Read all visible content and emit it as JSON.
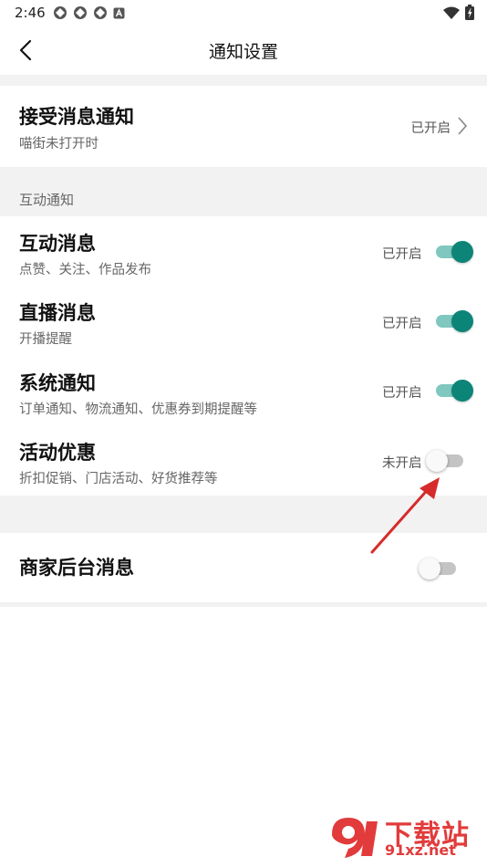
{
  "status_bar": {
    "time": "2:46"
  },
  "header": {
    "title": "通知设置"
  },
  "receive": {
    "title": "接受消息通知",
    "subtitle": "喵街未打开时",
    "status": "已开启"
  },
  "section": {
    "label": "互动通知"
  },
  "items": [
    {
      "title": "互动消息",
      "subtitle": "点赞、关注、作品发布",
      "status": "已开启",
      "enabled": true
    },
    {
      "title": "直播消息",
      "subtitle": "开播提醒",
      "status": "已开启",
      "enabled": true
    },
    {
      "title": "系统通知",
      "subtitle": "订单通知、物流通知、优惠券到期提醒等",
      "status": "已开启",
      "enabled": true
    },
    {
      "title": "活动优惠",
      "subtitle": "折扣促销、门店活动、好货推荐等",
      "status": "未开启",
      "enabled": false
    }
  ],
  "merchant": {
    "title": "商家后台消息",
    "enabled": false
  },
  "watermark": {
    "text": "下载站",
    "domain": "91xz.net"
  },
  "colors": {
    "toggle_on": "#0c8578",
    "toggle_on_track": "#7fc7bf",
    "toggle_off_track": "#c4c4c4",
    "arrow": "#d62b2b"
  }
}
